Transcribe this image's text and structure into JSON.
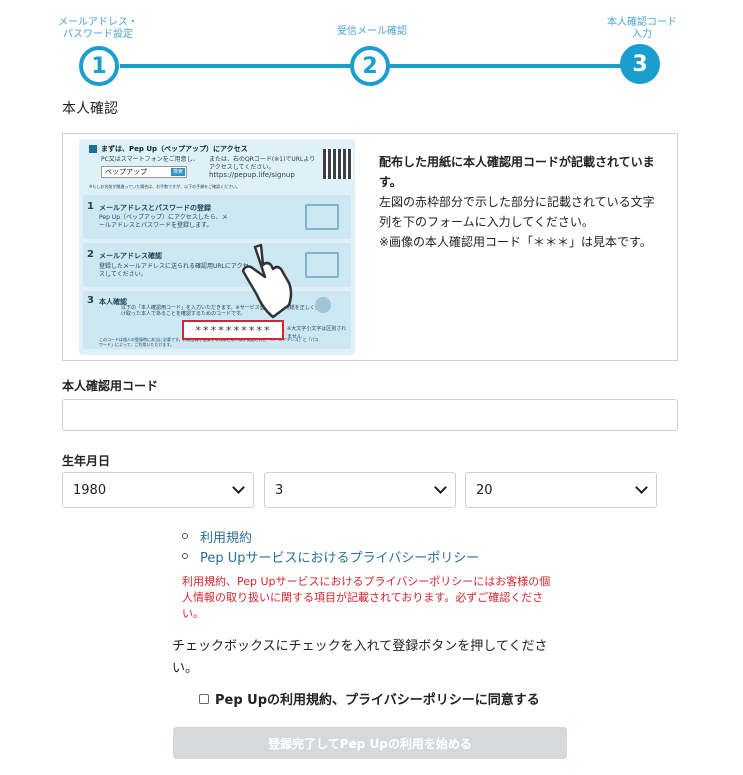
{
  "stepper": {
    "steps": [
      {
        "number": "1",
        "label_line1": "メールアドレス・",
        "label_line2": "パスワード設定"
      },
      {
        "number": "2",
        "label_line1": "受信メール確認",
        "label_line2": ""
      },
      {
        "number": "3",
        "label_line1": "本人確認コード",
        "label_line2": "入力"
      }
    ],
    "accent_color": "#1a9ed0"
  },
  "section_title": "本人確認",
  "guide_image": {
    "step0_title": "まずは、Pep Up（ペップアップ）にアクセス",
    "step0_note1": "PC又はスマートフォンをご用意し、",
    "step0_search_text": "ペップアップ",
    "step0_search_btn": "検索",
    "step0_note2": "または、右のQRコード(※1)でURLよりアクセスしてください。",
    "step0_url": "https://pepup.life/signup",
    "step0_footnote": "※もしお名前が間違っていた場合は、お手数ですが、以下の手順をご確認ください。",
    "step1_num": "1",
    "step1_title": "メールアドレスとパスワードの登録",
    "step1_desc": "Pep Up（ペップアップ）にアクセスしたら、メールアドレスとパスワードを登録します。",
    "step2_num": "2",
    "step2_title": "メールアドレス確認",
    "step2_desc": "登録したメールアドレスに送られる確認用URLにアクセスしてください。",
    "step3_num": "3",
    "step3_title": "本人確認",
    "step3_desc": "以下の「本人確認用コード」を入力いただきます。※サービス登録者が本用紙を正しく受け取った本人であることを確認するためのコードです。",
    "code_sample": "**********",
    "code_note": "※大文字小文字は区別されません",
    "bottom_note": "このコードは個人の登録時に本当に必要です。利用登録を放棄する際はご本人様が実施された「メールアドレス」と「パスワード」によって、ご利用いただけます。"
  },
  "info_text": {
    "bold": "配布した用紙に本人確認用コードが記載されています。",
    "line2": "左図の赤枠部分で示した部分に記載されている文字列を下のフォームに入力してください。",
    "line3": "※画像の本人確認用コード「＊＊＊」は見本です。"
  },
  "code_field": {
    "label": "本人確認用コード",
    "value": "",
    "placeholder": ""
  },
  "birthdate": {
    "label": "生年月日",
    "year": "1980",
    "month": "3",
    "day": "20"
  },
  "links": {
    "terms": "利用規約",
    "privacy": "Pep Upサービスにおけるプライバシーポリシー"
  },
  "notice": "利用規約、Pep Upサービスにおけるプライバシーポリシーにはお客様の個人情報の取り扱いに関する項目が記載されております。必ずご確認ください。",
  "instruction": "チェックボックスにチェックを入れて登録ボタンを押してください。",
  "agree_label": "Pep Upの利用規約、プライバシーポリシーに同意する",
  "submit_label": "登録完了してPep Upの利用を始める"
}
